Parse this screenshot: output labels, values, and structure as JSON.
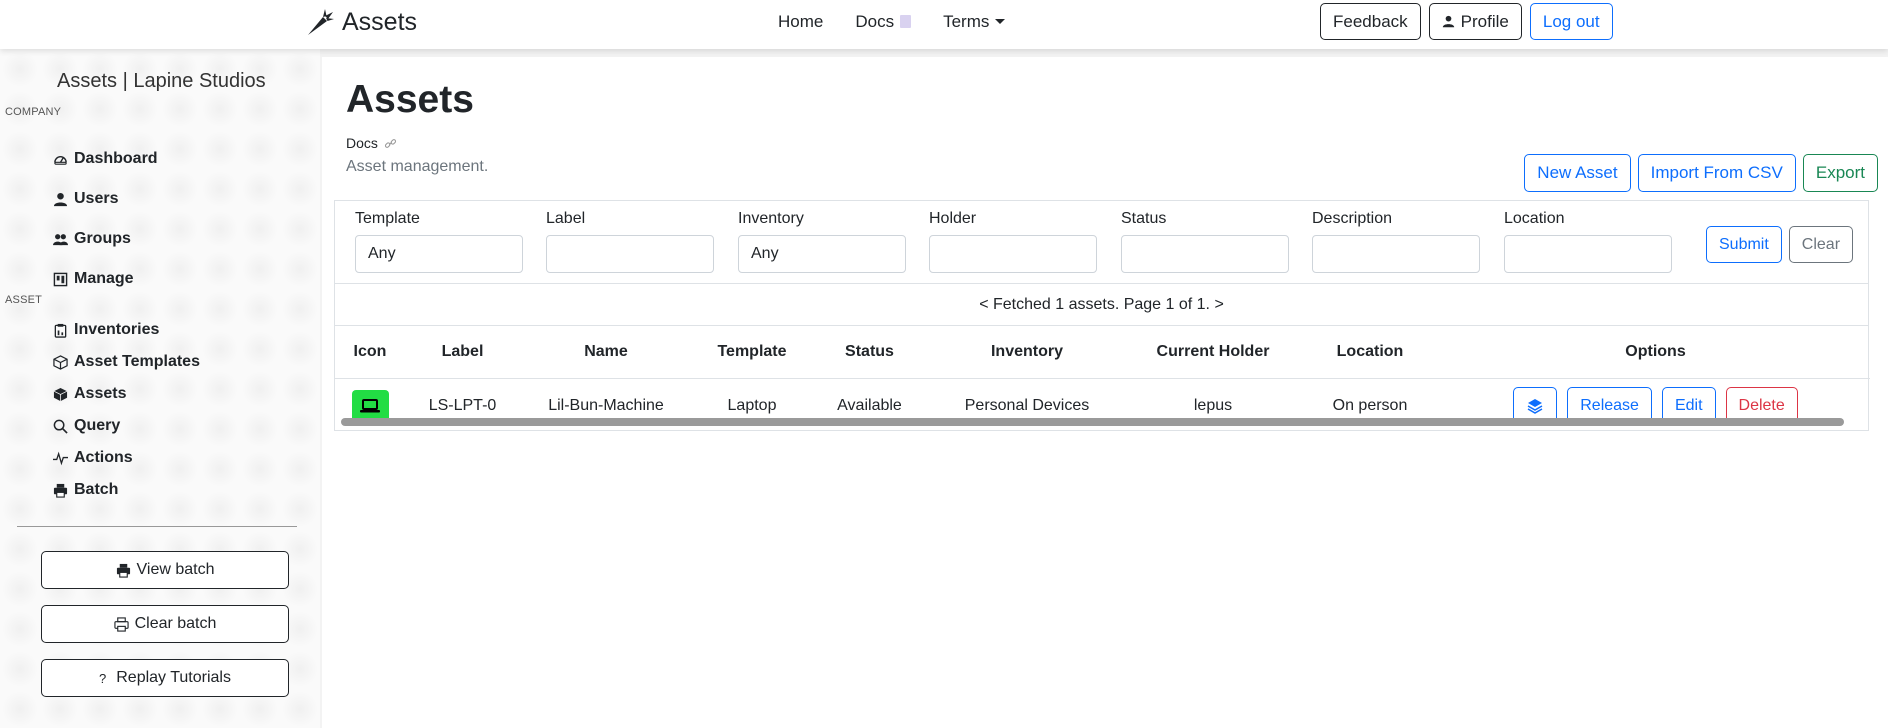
{
  "navbar": {
    "brand": "Assets",
    "links": [
      {
        "label": "Home"
      },
      {
        "label": "Docs"
      },
      {
        "label": "Terms"
      }
    ],
    "buttons": {
      "feedback": "Feedback",
      "profile": "Profile",
      "logout": "Log out"
    }
  },
  "sidebar": {
    "title": "Assets | Lapine Studios",
    "company_section": "COMPANY",
    "company_items": [
      {
        "label": "Dashboard",
        "icon": "dashboard-icon"
      },
      {
        "label": "Users",
        "icon": "user-icon"
      },
      {
        "label": "Groups",
        "icon": "group-icon"
      },
      {
        "label": "Manage",
        "icon": "manage-icon"
      }
    ],
    "asset_section": "ASSET",
    "asset_items": [
      {
        "label": "Inventories",
        "icon": "clipboard-icon"
      },
      {
        "label": "Asset Templates",
        "icon": "box-outline-icon"
      },
      {
        "label": "Assets",
        "icon": "box-solid-icon"
      },
      {
        "label": "Query",
        "icon": "search-icon"
      },
      {
        "label": "Actions",
        "icon": "activity-icon"
      },
      {
        "label": "Batch",
        "icon": "printer-icon"
      }
    ],
    "buttons": {
      "view_batch": "View batch",
      "clear_batch": "Clear batch",
      "replay_tutorials": "Replay Tutorials"
    }
  },
  "main": {
    "title": "Assets",
    "docs_link": "Docs",
    "description": "Asset management.",
    "actions": {
      "new_asset": "New Asset",
      "import_csv": "Import From CSV",
      "export": "Export"
    },
    "filters": {
      "template": {
        "label": "Template",
        "value": "Any"
      },
      "label": {
        "label": "Label",
        "value": ""
      },
      "inventory": {
        "label": "Inventory",
        "value": "Any"
      },
      "holder": {
        "label": "Holder",
        "value": ""
      },
      "status": {
        "label": "Status",
        "value": ""
      },
      "description": {
        "label": "Description",
        "value": ""
      },
      "location": {
        "label": "Location",
        "value": ""
      },
      "submit": "Submit",
      "clear": "Clear"
    },
    "pager": "< Fetched 1 assets. Page 1 of 1. >",
    "table": {
      "headers": [
        "Icon",
        "Label",
        "Name",
        "Template",
        "Status",
        "Inventory",
        "Current Holder",
        "Location",
        "Options"
      ],
      "rows": [
        {
          "icon": "laptop-icon",
          "icon_color": "#22dd44",
          "label": "LS-LPT-0",
          "name": "Lil-Bun-Machine",
          "template": "Laptop",
          "status": "Available",
          "inventory": "Personal Devices",
          "holder": "lepus",
          "location": "On person",
          "options": {
            "release": "Release",
            "edit": "Edit",
            "delete": "Delete"
          }
        }
      ]
    }
  }
}
